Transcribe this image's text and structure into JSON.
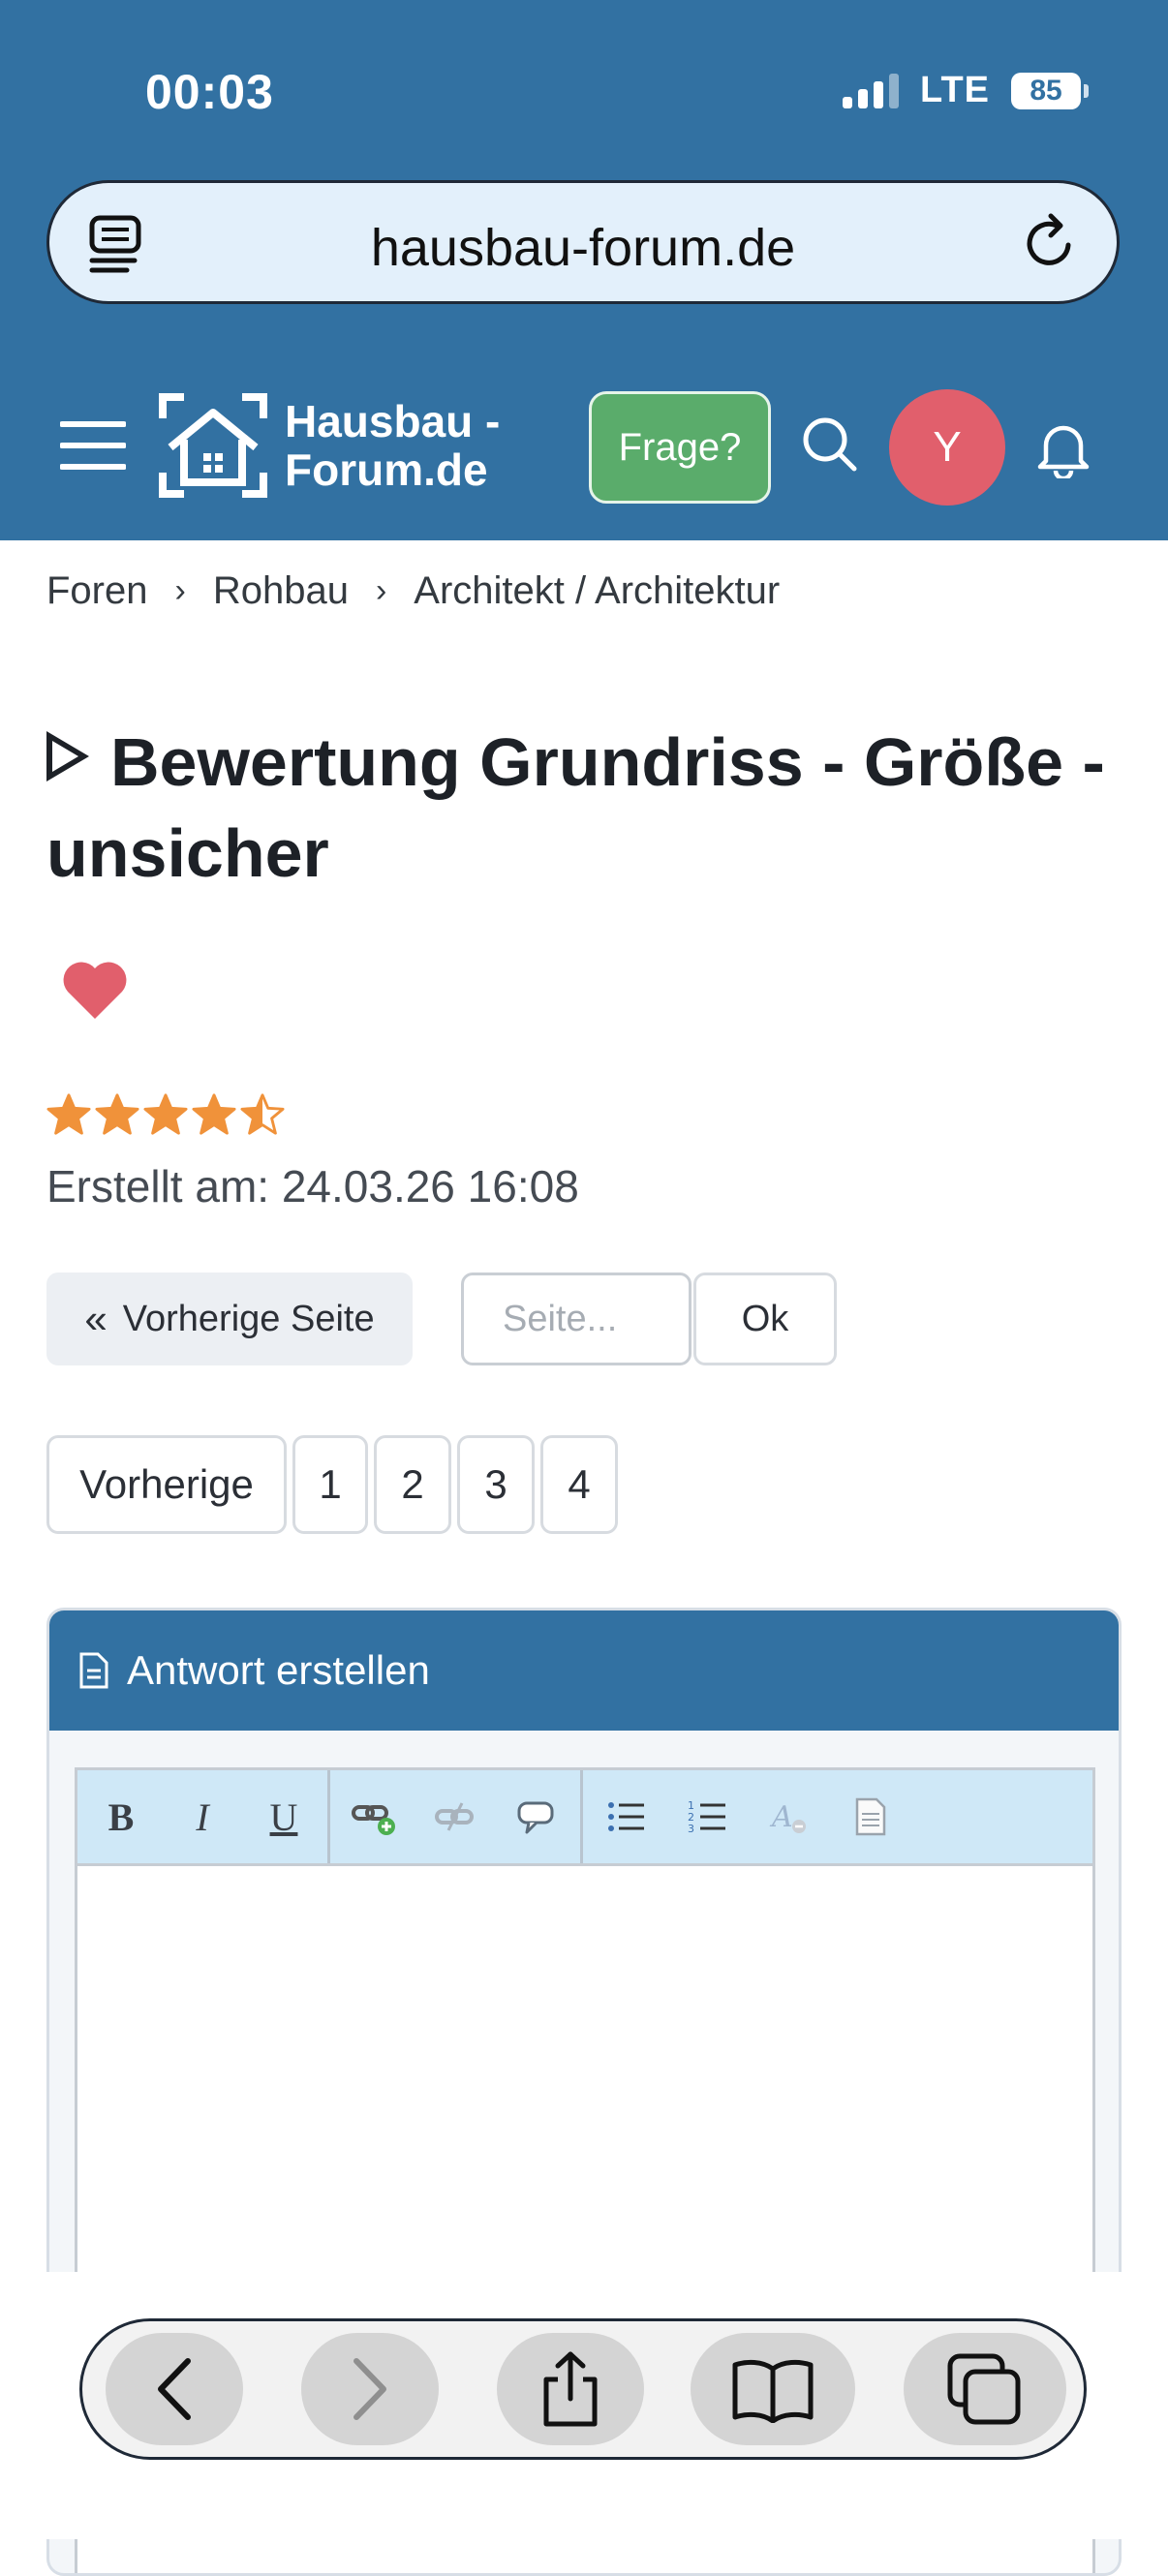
{
  "status": {
    "time": "00:03",
    "network": "LTE",
    "battery": "85"
  },
  "browser": {
    "url": "hausbau-forum.de"
  },
  "site": {
    "logo_line1": "Hausbau -",
    "logo_line2": "Forum.de",
    "ask_label": "Frage?",
    "avatar_letter": "Y"
  },
  "breadcrumb": [
    "Foren",
    "Rohbau",
    "Architekt / Architektur"
  ],
  "thread": {
    "title": "Bewertung Grundriss - Größe - unsicher",
    "rating": 4.5,
    "created": "Erstellt am: 24.03.26 16:08"
  },
  "nav": {
    "prev_page": "Vorherige Seite",
    "page_placeholder": "Seite...",
    "ok": "Ok",
    "pager": [
      "Vorherige",
      "1",
      "2",
      "3",
      "4"
    ]
  },
  "reply": {
    "header": "Antwort erstellen"
  },
  "colors": {
    "primary": "#3271a2",
    "ask": "#5aac6b",
    "avatar": "#e15f6c",
    "star": "#f0923a",
    "heart": "#e15f6c"
  }
}
